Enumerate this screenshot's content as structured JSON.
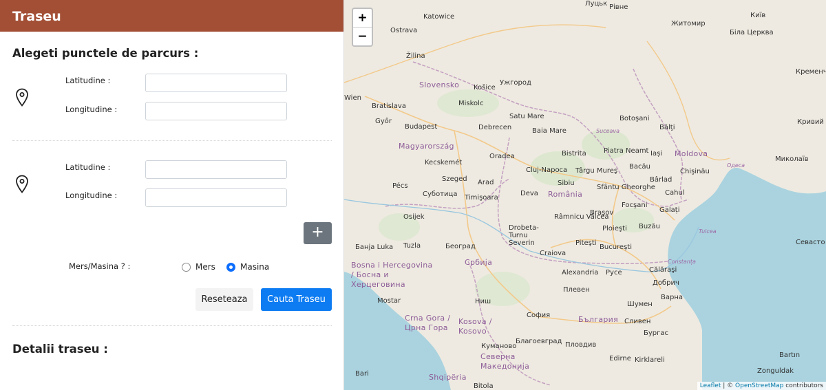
{
  "header": {
    "title": "Traseu"
  },
  "form": {
    "heading": "Alegeti punctele de parcurs :",
    "points": [
      {
        "lat_label": "Latitudine :",
        "lat_value": "",
        "lng_label": "Longitudine :",
        "lng_value": ""
      },
      {
        "lat_label": "Latitudine :",
        "lat_value": "",
        "lng_label": "Longitudine :",
        "lng_value": ""
      }
    ],
    "add_button": "+",
    "mode_label": "Mers/Masina ? :",
    "modes": [
      {
        "label": "Mers",
        "checked": false
      },
      {
        "label": "Masina",
        "checked": true
      }
    ],
    "reset_button": "Reseteaza",
    "search_button": "Cauta Traseu"
  },
  "details": {
    "heading": "Detalii traseu :"
  },
  "map": {
    "zoom_in": "+",
    "zoom_out": "−",
    "attribution": {
      "leaflet": "Leaflet",
      "sep": " | © ",
      "osm": "OpenStreetMap",
      "suffix": " contributors"
    },
    "labels": [
      {
        "text": "Луцьк",
        "cls": "city"
      },
      {
        "text": "Рівне",
        "cls": "city"
      },
      {
        "text": "Житомир",
        "cls": "city"
      },
      {
        "text": "Київ",
        "cls": "city"
      },
      {
        "text": "Біла Церква",
        "cls": "city"
      },
      {
        "text": "Кременчук",
        "cls": "city"
      },
      {
        "text": "Кривий",
        "cls": "city"
      },
      {
        "text": "Миколаїв",
        "cls": "city"
      },
      {
        "text": "Одеса",
        "cls": "city"
      },
      {
        "text": "Katowice",
        "cls": "city"
      },
      {
        "text": "Ostrava",
        "cls": "city"
      },
      {
        "text": "Žilina",
        "cls": "city"
      },
      {
        "text": "Slovensko",
        "cls": "country"
      },
      {
        "text": "Košice",
        "cls": "city"
      },
      {
        "text": "Ужгород",
        "cls": "city"
      },
      {
        "text": "Wien",
        "cls": "city"
      },
      {
        "text": "Bratislava",
        "cls": "city"
      },
      {
        "text": "Miskolc",
        "cls": "city"
      },
      {
        "text": "Győr",
        "cls": "city"
      },
      {
        "text": "Budapest",
        "cls": "city"
      },
      {
        "text": "Debrecen",
        "cls": "city"
      },
      {
        "text": "Satu Mare",
        "cls": "city"
      },
      {
        "text": "Baia Mare",
        "cls": "city"
      },
      {
        "text": "Suceava",
        "cls": "city"
      },
      {
        "text": "Botoşani",
        "cls": "city"
      },
      {
        "text": "Bălţi",
        "cls": "city"
      },
      {
        "text": "Magyarország",
        "cls": "country"
      },
      {
        "text": "Oradea",
        "cls": "city"
      },
      {
        "text": "Bistrita",
        "cls": "city"
      },
      {
        "text": "Piatra Neamt",
        "cls": "city"
      },
      {
        "text": "Iași",
        "cls": "city"
      },
      {
        "text": "Moldova",
        "cls": "country"
      },
      {
        "text": "Kecskemét",
        "cls": "city"
      },
      {
        "text": "Cluj-Napoca",
        "cls": "city"
      },
      {
        "text": "Târgu Mureş",
        "cls": "city"
      },
      {
        "text": "Bacău",
        "cls": "city"
      },
      {
        "text": "Chişinău",
        "cls": "city"
      },
      {
        "text": "Szeged",
        "cls": "city"
      },
      {
        "text": "Arad",
        "cls": "city"
      },
      {
        "text": "Sibiu",
        "cls": "city"
      },
      {
        "text": "Sfântu Gheorghe",
        "cls": "city"
      },
      {
        "text": "Bârlad",
        "cls": "city"
      },
      {
        "text": "Pécs",
        "cls": "city"
      },
      {
        "text": "Суботица",
        "cls": "city"
      },
      {
        "text": "Timişoara",
        "cls": "city"
      },
      {
        "text": "Deva",
        "cls": "city"
      },
      {
        "text": "România",
        "cls": "country"
      },
      {
        "text": "Cahul",
        "cls": "city"
      },
      {
        "text": "Focşani",
        "cls": "city"
      },
      {
        "text": "Galați",
        "cls": "city"
      },
      {
        "text": "Osijek",
        "cls": "city"
      },
      {
        "text": "Braşov",
        "cls": "city"
      },
      {
        "text": "Râmnicu Vâlcea",
        "cls": "city"
      },
      {
        "text": "Ploieşti",
        "cls": "city"
      },
      {
        "text": "Buzău",
        "cls": "city"
      },
      {
        "text": "Tulcea",
        "cls": "city"
      },
      {
        "text": "Банja Luka",
        "cls": "city"
      },
      {
        "text": "Tuzla",
        "cls": "city"
      },
      {
        "text": "Београд",
        "cls": "city"
      },
      {
        "text": "Drobeta-Turnu Severin",
        "cls": "city"
      },
      {
        "text": "Piteşti",
        "cls": "city"
      },
      {
        "text": "Bucureşti",
        "cls": "city"
      },
      {
        "text": "Constanța",
        "cls": "city"
      },
      {
        "text": "Севасто",
        "cls": "city"
      },
      {
        "text": "Bosna i Hercegovina / Босна и Херцеговина",
        "cls": "country"
      },
      {
        "text": "Србија",
        "cls": "country"
      },
      {
        "text": "Craiova",
        "cls": "city"
      },
      {
        "text": "Alexandria",
        "cls": "city"
      },
      {
        "text": "Русе",
        "cls": "city"
      },
      {
        "text": "Călăraşi",
        "cls": "city"
      },
      {
        "text": "Добрич",
        "cls": "city"
      },
      {
        "text": "Плевен",
        "cls": "city"
      },
      {
        "text": "Варна",
        "cls": "city"
      },
      {
        "text": "Mostar",
        "cls": "city"
      },
      {
        "text": "Ниш",
        "cls": "city"
      },
      {
        "text": "Шумен",
        "cls": "city"
      },
      {
        "text": "Crna Gora / Црна Гора",
        "cls": "country"
      },
      {
        "text": "Kosova / Kosovo",
        "cls": "country"
      },
      {
        "text": "София",
        "cls": "city"
      },
      {
        "text": "България",
        "cls": "country"
      },
      {
        "text": "Сливен",
        "cls": "city"
      },
      {
        "text": "Бургас",
        "cls": "city"
      },
      {
        "text": "Куманово",
        "cls": "city"
      },
      {
        "text": "Благоевград",
        "cls": "city"
      },
      {
        "text": "Пловдив",
        "cls": "city"
      },
      {
        "text": "Северна Македонија",
        "cls": "country"
      },
      {
        "text": "Edirne",
        "cls": "city"
      },
      {
        "text": "Kirklareli",
        "cls": "city"
      },
      {
        "text": "Bartın",
        "cls": "city"
      },
      {
        "text": "Bari",
        "cls": "city"
      },
      {
        "text": "Shqipëria",
        "cls": "country"
      },
      {
        "text": "Zonguldak",
        "cls": "city"
      },
      {
        "text": "Bitola",
        "cls": "city"
      }
    ]
  }
}
